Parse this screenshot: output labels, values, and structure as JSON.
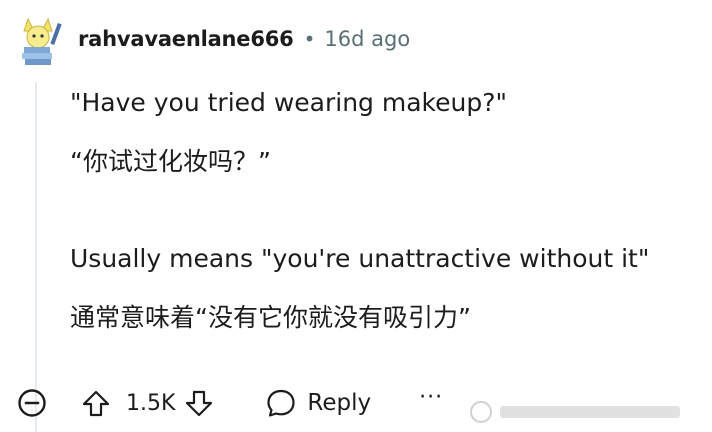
{
  "comment": {
    "author": "rahvavaenlane666",
    "separator": "•",
    "timestamp": "16d ago",
    "lines": [
      "\"Have you tried wearing makeup?\"",
      "“你试过化妆吗？”",
      "Usually means \"you're unattractive without it\"",
      "通常意味着“没有它你就没有吸引力”"
    ]
  },
  "actions": {
    "score": "1.5K",
    "reply_label": "Reply",
    "more_label": "···"
  },
  "icons": {
    "collapse": "minus-circle-icon",
    "upvote": "arrow-up-icon",
    "downvote": "arrow-down-icon",
    "reply": "speech-bubble-icon",
    "more": "ellipsis-icon"
  },
  "colors": {
    "text": "#1c1c1c",
    "meta": "#576f76",
    "thread_line": "#e5ebee"
  }
}
